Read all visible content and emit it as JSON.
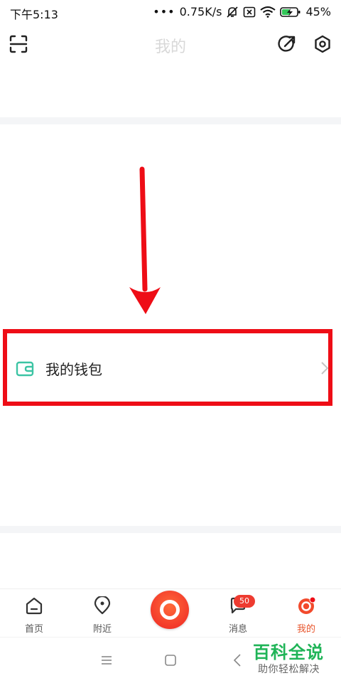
{
  "status_bar": {
    "time": "下午5:13",
    "network_speed": "0.75K/s",
    "battery": "45%"
  },
  "header": {
    "title": "我的"
  },
  "wallet": {
    "label": "我的钱包",
    "icon_color": "#3cc4a4"
  },
  "annotation": {
    "color": "#ee0d16"
  },
  "bottom_nav": {
    "items": [
      {
        "label": "首页"
      },
      {
        "label": "附近"
      },
      {
        "label": "消息",
        "badge": "50"
      },
      {
        "label": "我的"
      }
    ],
    "active_color": "#e8552c"
  },
  "watermark": {
    "title": "百科全说",
    "subtitle": "助你轻松解决"
  }
}
